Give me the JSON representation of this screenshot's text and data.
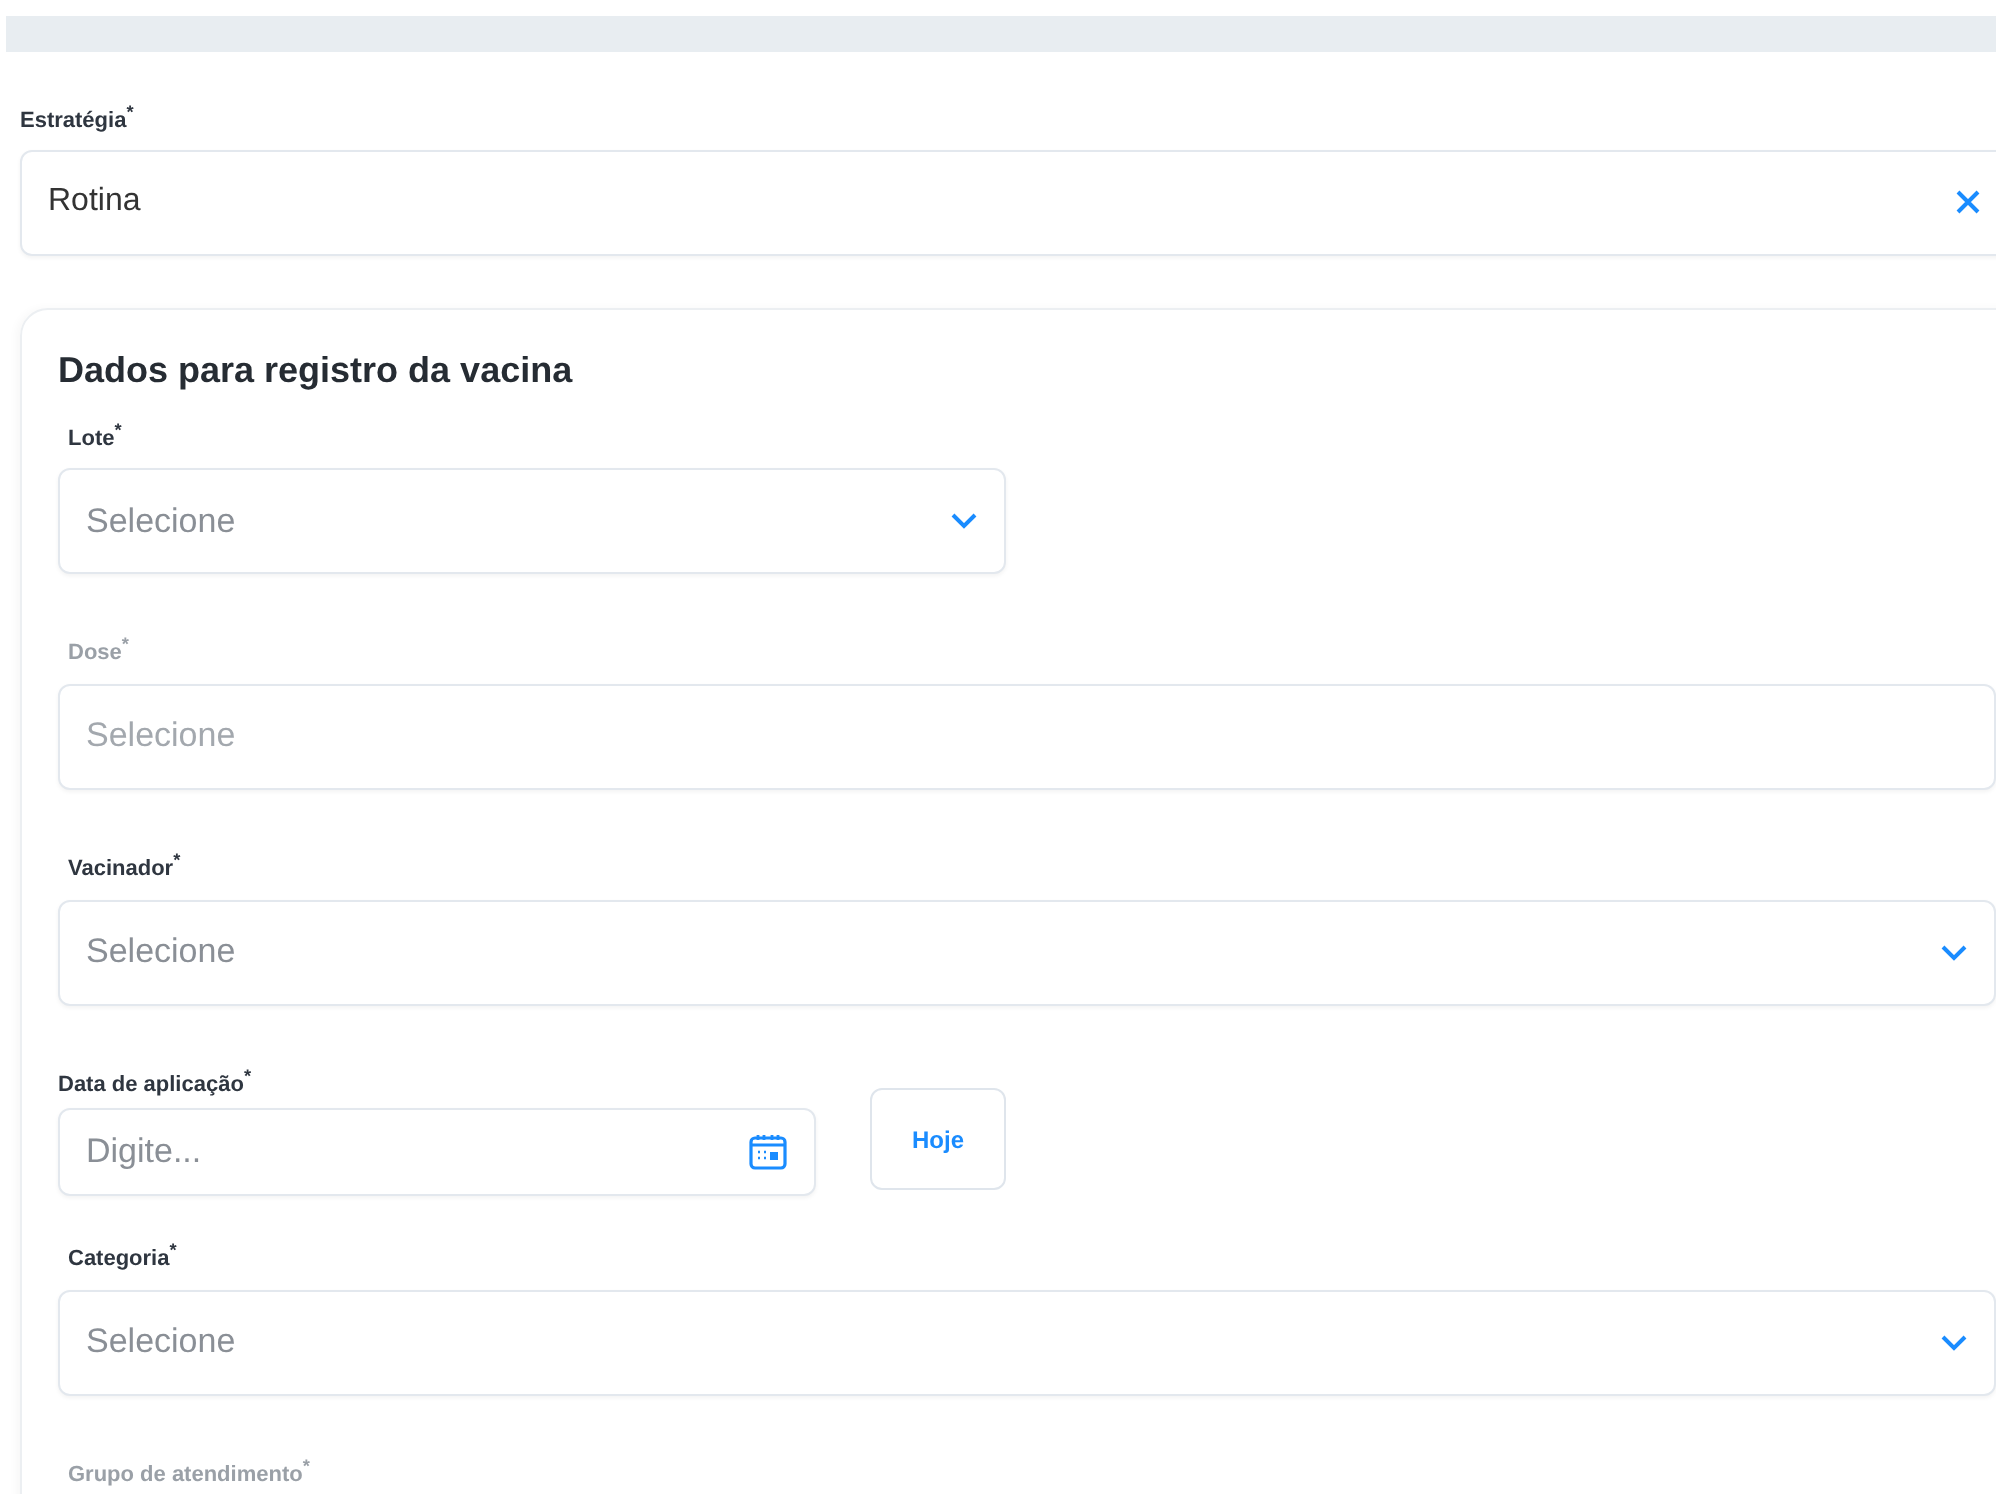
{
  "strategy": {
    "label": "Estratégia$^{*}$",
    "value": "Rotina",
    "clearable": true
  },
  "card": {
    "title": "Dados para registro da vacina",
    "fields": [
      {
        "kind": "select",
        "label": "Lote$^{*}$",
        "placeholder": "Selecione",
        "disabled": false,
        "short": true
      },
      {
        "kind": "select",
        "label": "Dose$^{*}$",
        "placeholder": "Selecione",
        "disabled": true,
        "short": false
      },
      {
        "kind": "select",
        "label": "Vacinador$^{*}$",
        "placeholder": "Selecione",
        "disabled": false,
        "short": false
      },
      {
        "kind": "date",
        "label": "Data de aplicação$^{*}$",
        "placeholder": "Digite...",
        "disabled": false,
        "button": "Hoje"
      },
      {
        "kind": "select",
        "label": "Categoria$^{*}$",
        "placeholder": "Selecione",
        "disabled": false,
        "short": false
      },
      {
        "kind": "label",
        "label": "Grupo de atendimento$^{*}$",
        "disabled": true
      }
    ]
  }
}
